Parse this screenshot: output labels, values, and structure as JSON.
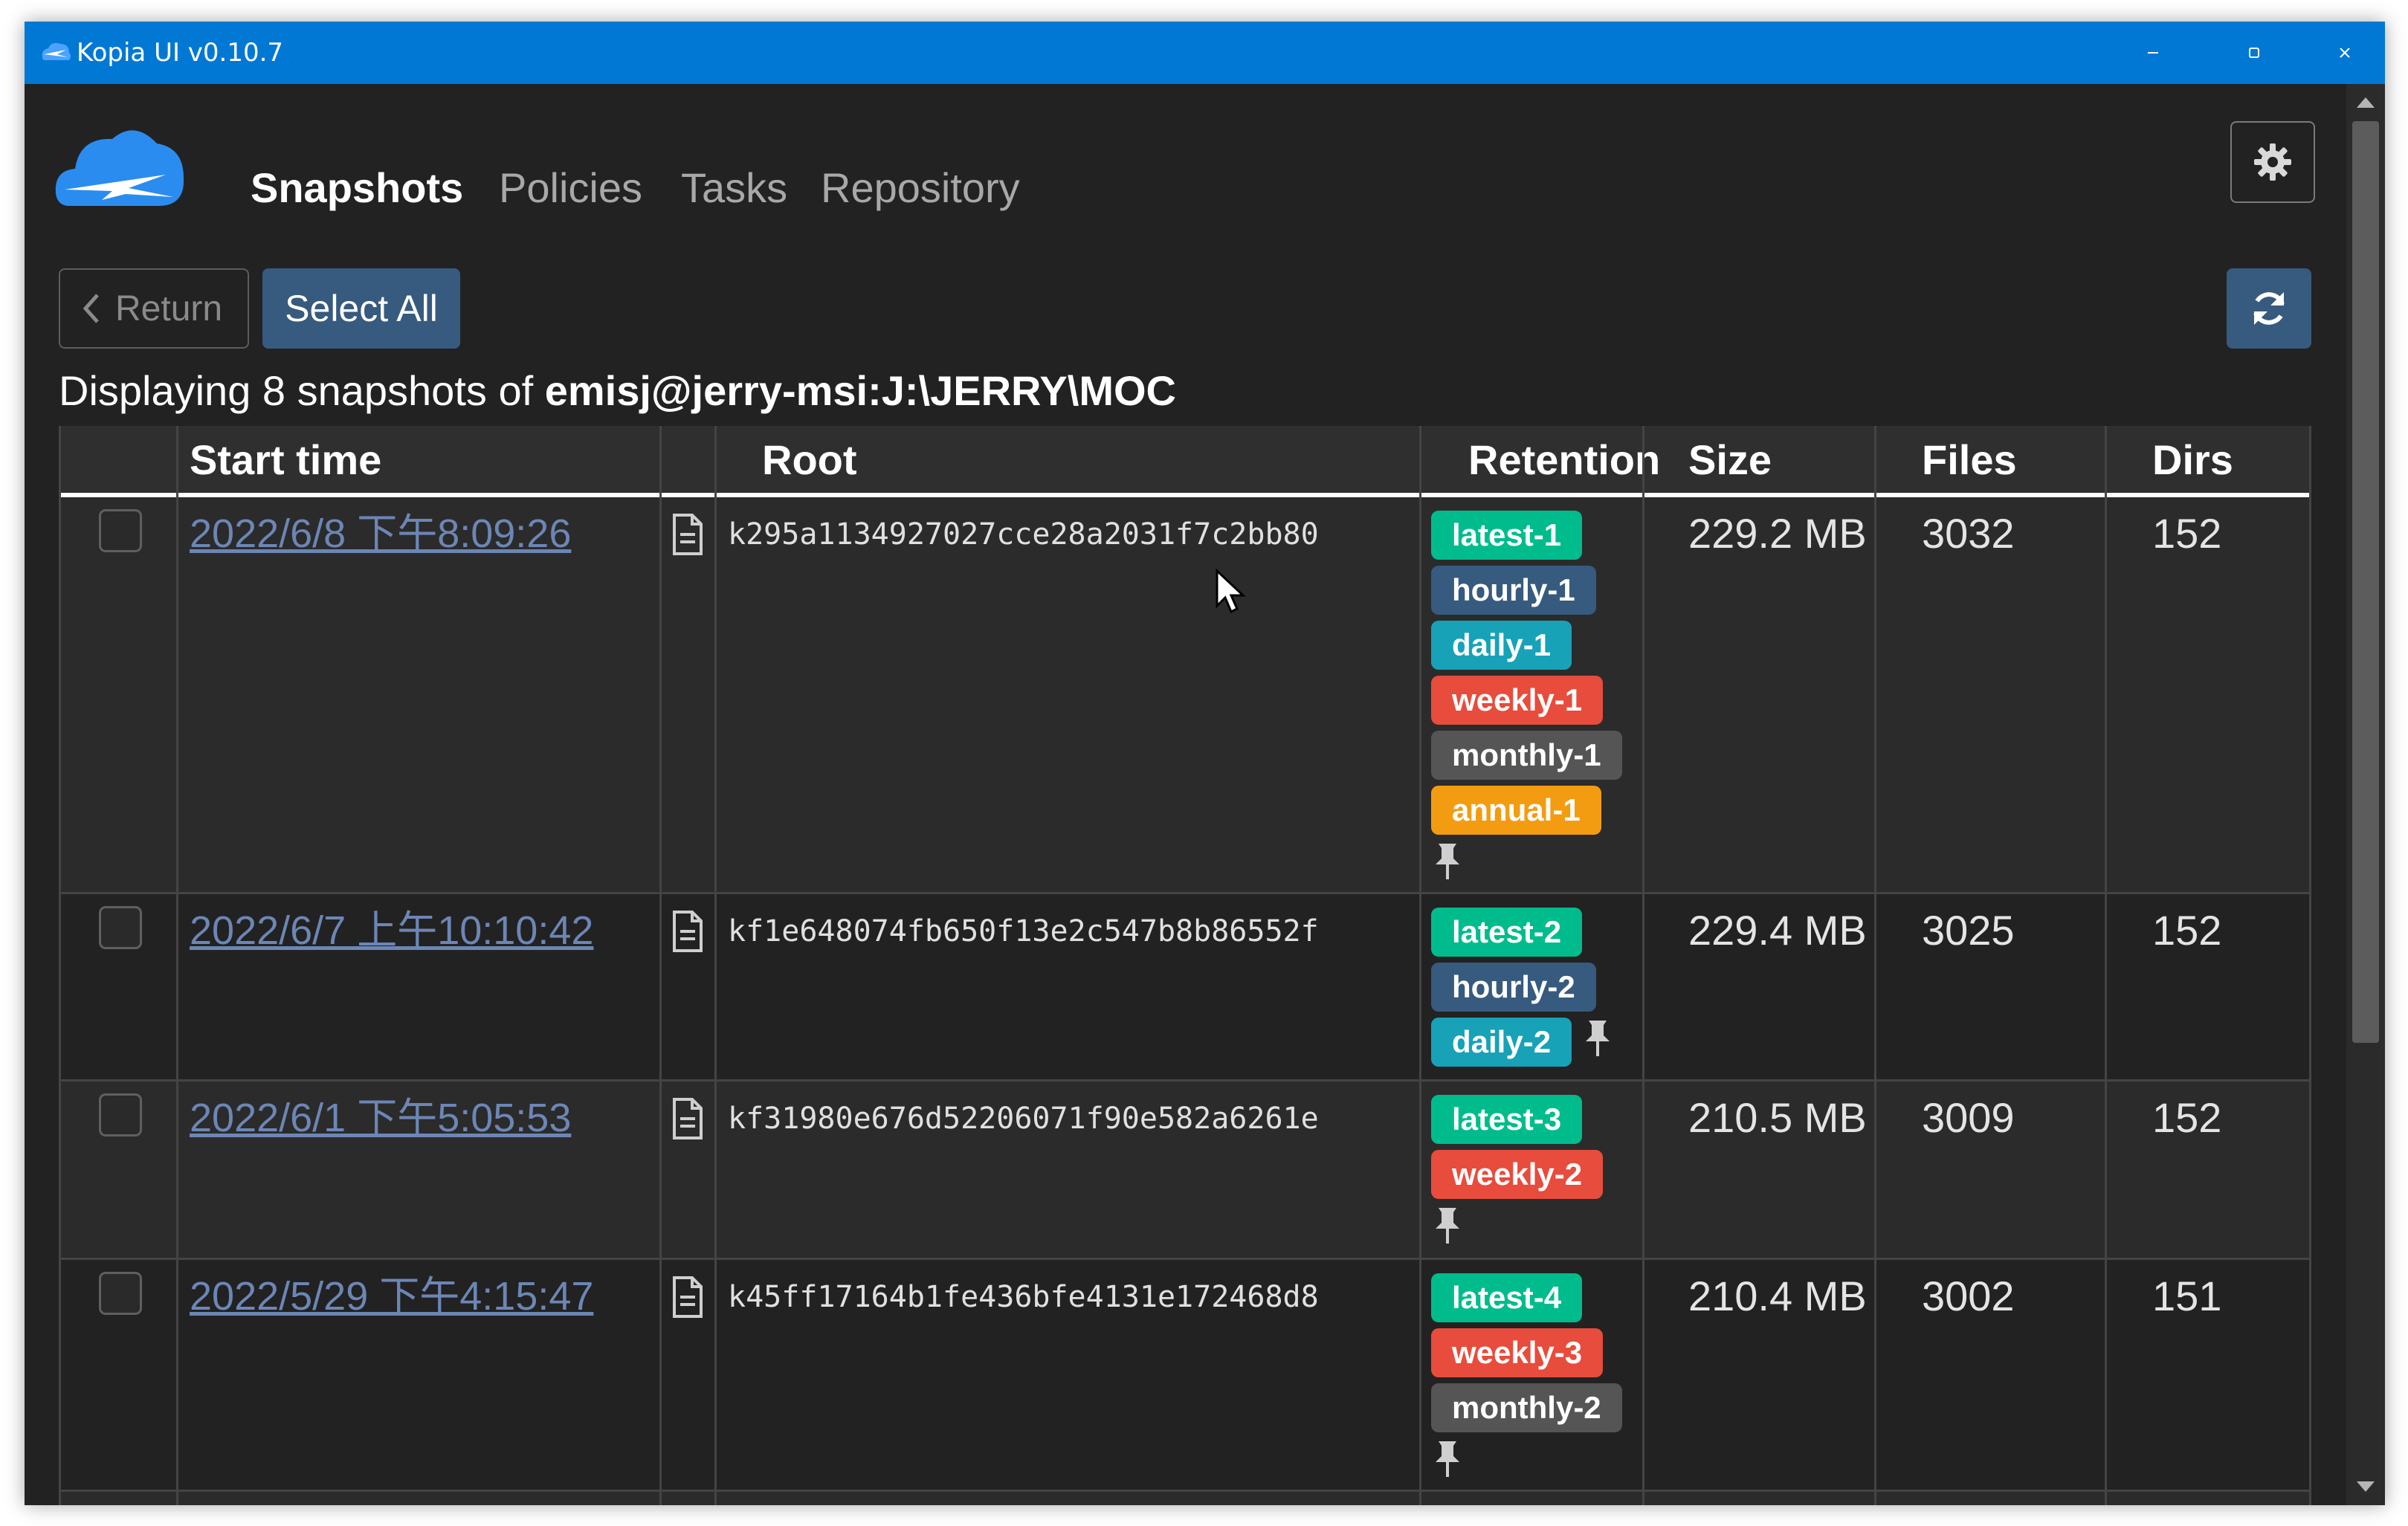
{
  "window": {
    "title": "Kopia UI v0.10.7"
  },
  "nav": {
    "items": [
      {
        "label": "Snapshots",
        "active": true
      },
      {
        "label": "Policies"
      },
      {
        "label": "Tasks"
      },
      {
        "label": "Repository"
      }
    ]
  },
  "toolbar": {
    "return_label": "Return",
    "select_all_label": "Select All"
  },
  "caption": {
    "prefix": "Displaying 8 snapshots of ",
    "source": "emisj@jerry-msi:J:\\JERRY\\MOC"
  },
  "table": {
    "headers": [
      "Start time",
      "Root",
      "Retention",
      "Size",
      "Files",
      "Dirs"
    ],
    "rows": [
      {
        "start_time": "2022/6/8 下午8:09:26",
        "root": "k295a1134927027cce28a2031f7c2bb80",
        "retention": [
          "latest-1",
          "hourly-1",
          "daily-1",
          "weekly-1",
          "monthly-1",
          "annual-1"
        ],
        "size": "229.2 MB",
        "files": "3032",
        "dirs": "152"
      },
      {
        "start_time": "2022/6/7 上午10:10:42",
        "root": "kf1e648074fb650f13e2c547b8b86552f",
        "retention": [
          "latest-2",
          "hourly-2",
          "daily-2"
        ],
        "size": "229.4 MB",
        "files": "3025",
        "dirs": "152"
      },
      {
        "start_time": "2022/6/1 下午5:05:53",
        "root": "kf31980e676d52206071f90e582a6261e",
        "retention": [
          "latest-3",
          "weekly-2"
        ],
        "size": "210.5 MB",
        "files": "3009",
        "dirs": "152"
      },
      {
        "start_time": "2022/5/29 下午4:15:47",
        "root": "k45ff17164b1fe436bfe4131e172468d8",
        "retention": [
          "latest-4",
          "weekly-3",
          "monthly-2"
        ],
        "size": "210.4 MB",
        "files": "3002",
        "dirs": "151"
      }
    ]
  },
  "colors": {
    "titlebar": "#0078d4",
    "background": "#222222",
    "primary": "#375a7f",
    "link": "#6c86b5",
    "latest": "#00bc8c",
    "hourly": "#375a7f",
    "daily": "#17a2b8",
    "weekly": "#e74c3c",
    "monthly": "#555555",
    "annual": "#f39c12"
  },
  "icons": [
    "kopia-logo-icon",
    "minimize-icon",
    "maximize-icon",
    "close-icon",
    "gear-icon",
    "chevron-left-icon",
    "refresh-icon",
    "document-icon",
    "pin-icon"
  ]
}
